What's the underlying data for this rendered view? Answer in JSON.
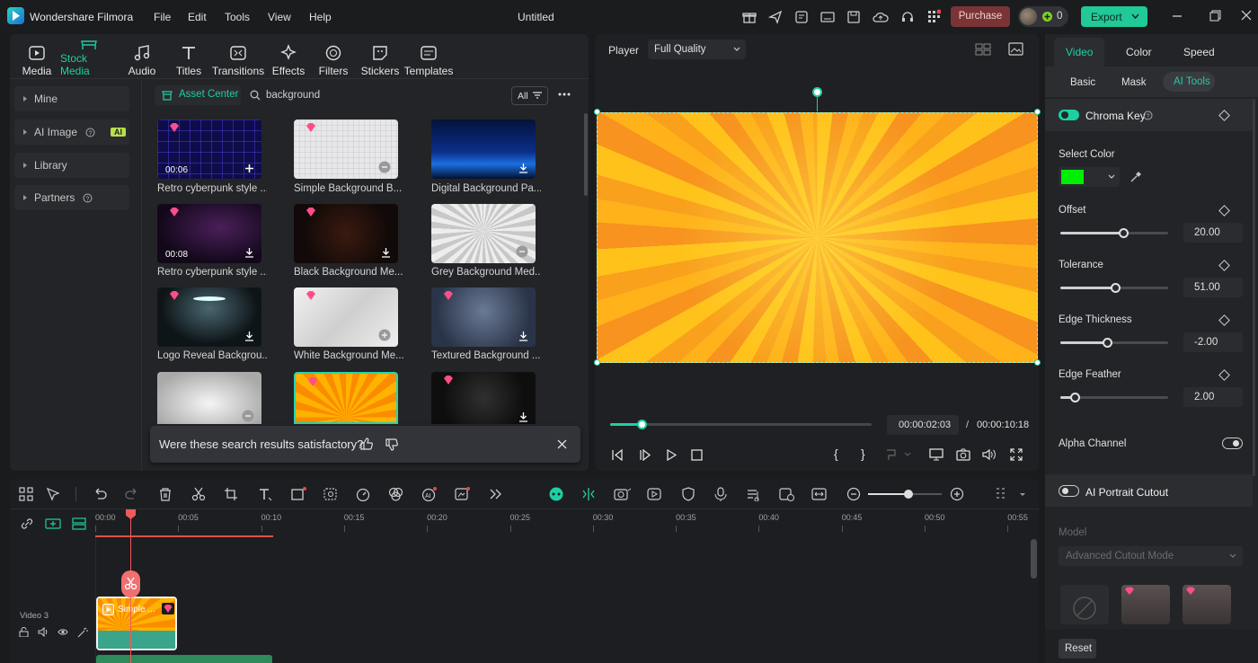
{
  "app": {
    "title": "Wondershare Filmora",
    "doc_title": "Untitled",
    "menus": [
      "File",
      "Edit",
      "Tools",
      "View",
      "Help"
    ],
    "purchase": "Purchase",
    "credits": "0",
    "export": "Export"
  },
  "nav": {
    "tabs": [
      "Media",
      "Stock Media",
      "Audio",
      "Titles",
      "Transitions",
      "Effects",
      "Filters",
      "Stickers",
      "Templates"
    ],
    "active": "Stock Media"
  },
  "sidebar": {
    "items": [
      {
        "label": "Mine"
      },
      {
        "label": "AI Image",
        "badge": "AI"
      },
      {
        "label": "Library"
      },
      {
        "label": "Partners"
      }
    ]
  },
  "assets": {
    "center_label": "Asset Center",
    "search_value": "background",
    "filter_label": "All",
    "items": [
      {
        "title": "Retro cyberpunk style ...",
        "duration": "00:06"
      },
      {
        "title": "Simple Background B..."
      },
      {
        "title": "Digital Background Pa..."
      },
      {
        "title": "Retro cyberpunk style ...",
        "duration": "00:08"
      },
      {
        "title": "Black Background Me..."
      },
      {
        "title": "Grey Background Med..."
      },
      {
        "title": "Logo Reveal Backgrou..."
      },
      {
        "title": "White Background Me..."
      },
      {
        "title": "Textured Background ..."
      }
    ],
    "feedback": "Were these search results satisfactory?"
  },
  "player": {
    "label": "Player",
    "quality": "Full Quality",
    "current_time": "00:00:02:03",
    "separator": "/",
    "total_time": "00:00:10:18",
    "progress": 0.12
  },
  "inspector": {
    "tabs": [
      "Video",
      "Color",
      "Speed"
    ],
    "subtabs": [
      "Basic",
      "Mask",
      "AI Tools"
    ],
    "chroma_key": "Chroma Key",
    "select_color": "Select Color",
    "key_color": "#00ee00",
    "params": [
      {
        "label": "Offset",
        "value": "20.00",
        "fraction": 0.58
      },
      {
        "label": "Tolerance",
        "value": "51.00",
        "fraction": 0.51
      },
      {
        "label": "Edge Thickness",
        "value": "-2.00",
        "fraction": 0.43
      },
      {
        "label": "Edge Feather",
        "value": "2.00",
        "fraction": 0.13
      }
    ],
    "alpha_channel": "Alpha Channel",
    "ai_portrait": "AI Portrait Cutout",
    "model_label": "Model",
    "model_value": "Advanced Cutout Mode",
    "reset": "Reset"
  },
  "timeline": {
    "ruler": [
      "00:00",
      "00:05",
      "00:10",
      "00:15",
      "00:20",
      "00:25",
      "00:30",
      "00:35",
      "00:40",
      "00:45",
      "00:50",
      "00:55"
    ],
    "track_label": "Video 3",
    "clip_label": "Simple ...",
    "zoom": 0.55
  },
  "colors": {
    "accent": "#1ecfa3",
    "export": "#20c997",
    "purchase": "#7a3436",
    "playhead": "#f05a5a",
    "preview_orange": "#f7a21a",
    "preview_yellow": "#ffc21a"
  }
}
